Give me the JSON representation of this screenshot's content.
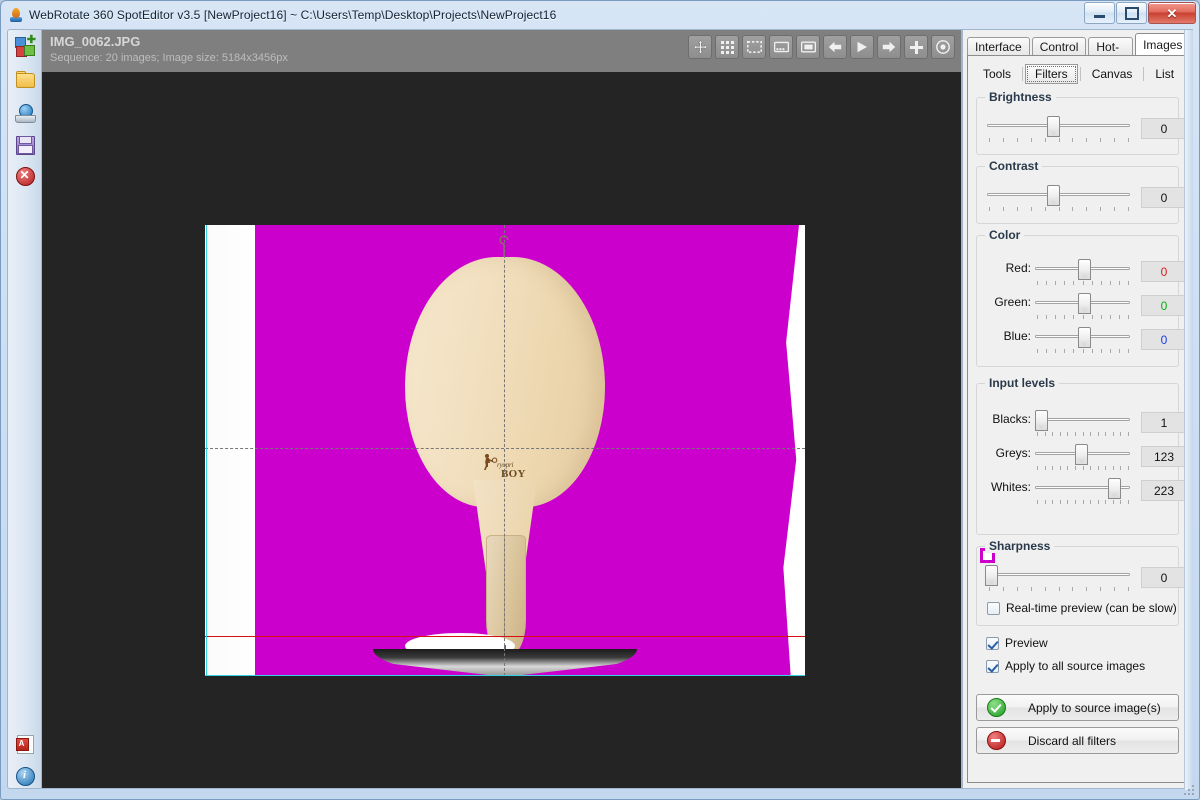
{
  "window": {
    "title": "WebRotate 360 SpotEditor v3.5 [NewProject16] ~ C:\\Users\\Temp\\Desktop\\Projects\\NewProject16",
    "app_icon": "droplet-icon",
    "minimize_label": "Minimize",
    "maximize_label": "Maximize",
    "close_label": "Close"
  },
  "left_rail": {
    "items": [
      {
        "name": "new-project",
        "icon": "new-project-icon",
        "tooltip": "New project"
      },
      {
        "name": "open-project",
        "icon": "open-folder-icon",
        "tooltip": "Open project"
      },
      {
        "name": "publish-project",
        "icon": "publish-globe-icon",
        "tooltip": "Publish"
      },
      {
        "name": "save-project",
        "icon": "save-floppy-icon",
        "tooltip": "Save project"
      },
      {
        "name": "close-project",
        "icon": "close-circle-icon",
        "tooltip": "Close project"
      }
    ],
    "bottom_items": [
      {
        "name": "help-pdf",
        "icon": "pdf-document-icon",
        "tooltip": "Help PDF"
      },
      {
        "name": "about-info",
        "icon": "info-circle-icon",
        "tooltip": "About"
      }
    ]
  },
  "image_header": {
    "filename": "IMG_0062.JPG",
    "meta": "Sequence: 20 images; Image size: 5184x3456px"
  },
  "toolbar": {
    "buttons": [
      {
        "name": "pan-tool",
        "icon": "move-arrows-icon"
      },
      {
        "name": "grid-view",
        "icon": "grid-icon"
      },
      {
        "name": "crop-select",
        "icon": "marquee-select-icon"
      },
      {
        "name": "filmstrip-view",
        "icon": "filmstrip-icon"
      },
      {
        "name": "single-frame-view",
        "icon": "single-frame-icon"
      },
      {
        "name": "previous-frame",
        "icon": "arrow-left-icon"
      },
      {
        "name": "play-sequence",
        "icon": "play-icon"
      },
      {
        "name": "next-frame",
        "icon": "arrow-right-icon"
      },
      {
        "name": "add-image",
        "icon": "plus-icon"
      },
      {
        "name": "record-spin",
        "icon": "target-record-icon"
      }
    ]
  },
  "canvas": {
    "mask_color": "#cc00cc",
    "guide_color": "#35d3e8",
    "baseline_color": "#d81010",
    "background": "#242424",
    "product_logo_script": "ryopri",
    "product_logo_word": "BOY"
  },
  "panel": {
    "main_tabs": [
      {
        "label": "Interface",
        "active": false
      },
      {
        "label": "Control",
        "active": false
      },
      {
        "label": "Hot-spots",
        "active": false
      },
      {
        "label": "Images",
        "active": true
      }
    ],
    "sub_tabs": [
      {
        "label": "Tools",
        "active": false
      },
      {
        "label": "Filters",
        "active": true
      },
      {
        "label": "Canvas",
        "active": false
      },
      {
        "label": "List",
        "active": false
      }
    ],
    "groups": {
      "brightness": {
        "title": "Brightness",
        "value": "0",
        "percent": 50
      },
      "contrast": {
        "title": "Contrast",
        "value": "0",
        "percent": 50
      },
      "color": {
        "title": "Color",
        "channels": [
          {
            "label": "Red:",
            "value": "0",
            "percent": 50,
            "color": "#e01b1b"
          },
          {
            "label": "Green:",
            "value": "0",
            "percent": 50,
            "color": "#0fae0f"
          },
          {
            "label": "Blue:",
            "value": "0",
            "percent": 50,
            "color": "#1b3fe0"
          }
        ]
      },
      "input_levels": {
        "title": "Input levels",
        "channels": [
          {
            "label": "Blacks:",
            "value": "1",
            "percent": 1
          },
          {
            "label": "Greys:",
            "value": "123",
            "percent": 45
          },
          {
            "label": "Whites:",
            "value": "223",
            "percent": 83
          }
        ],
        "mask_swatch_color": "#cc00cc"
      },
      "sharpness": {
        "title": "Sharpness",
        "value": "0",
        "percent": 0,
        "realtime_label": "Real-time preview (can be slow)",
        "realtime_checked": false
      }
    },
    "options": [
      {
        "label": "Preview",
        "checked": true
      },
      {
        "label": "Apply to all source images",
        "checked": true
      }
    ],
    "actions": [
      {
        "label": "Apply to source image(s)",
        "icon": "green-check-icon"
      },
      {
        "label": "Discard all filters",
        "icon": "red-minus-icon"
      }
    ]
  }
}
